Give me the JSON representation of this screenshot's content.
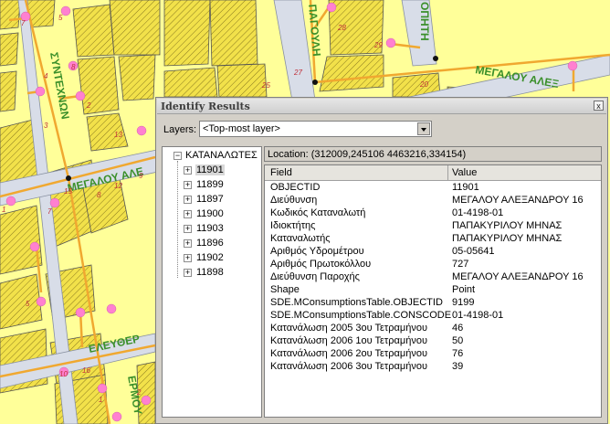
{
  "map": {
    "streets": [
      "ΣΥΝΤΕΧΝΩΝ",
      "ΠΑΓΟΥΛΗ",
      "ΟΠΗΤΗ",
      "ΜΕΓΑΛΟΥ ΑΛΕΞ",
      "ΜΕΓΑΛΟΥ ΑΛΕ",
      "ΕΛΕΥΘΕΡ",
      "ΕΡΜΟΥ"
    ],
    "parcel_numbers": [
      "7",
      "5",
      "8",
      "4",
      "3",
      "2",
      "13",
      "27",
      "28",
      "29",
      "20",
      "25",
      "9",
      "15",
      "12",
      "8",
      "1",
      "7",
      "5",
      "10",
      "16",
      "1",
      "2"
    ],
    "colors": {
      "background": "#ffff99",
      "road": "#d8dde8",
      "pipe": "#f0a830",
      "meter": "#ff80d0",
      "label": "#3a8f2a"
    }
  },
  "dialog": {
    "title": "Identify Results",
    "close_glyph": "x",
    "layers_label": "Layers:",
    "layers_value": "<Top-most layer>",
    "tree": {
      "root": "ΚΑΤΑΝΑΛΩΤΕΣ",
      "root_expander": "−",
      "child_expander": "+",
      "items": [
        "11901",
        "11899",
        "11897",
        "11900",
        "11903",
        "11896",
        "11902",
        "11898"
      ]
    },
    "location_text": "Location: (312009,245106 4463216,334154)",
    "grid": {
      "headers": [
        "Field",
        "Value"
      ],
      "rows": [
        {
          "field": "OBJECTID",
          "value": "11901"
        },
        {
          "field": "Διεύθυνση",
          "value": "ΜΕΓΑΛΟΥ ΑΛΕΞΑΝΔΡΟΥ 16"
        },
        {
          "field": "Κωδικός Καταναλωτή",
          "value": "01-4198-01"
        },
        {
          "field": "Ιδιοκτήτης",
          "value": "ΠΑΠΑΚΥΡΙΛΟΥ ΜΗΝΑΣ"
        },
        {
          "field": "Καταναλωτής",
          "value": "ΠΑΠΑΚΥΡΙΛΟΥ ΜΗΝΑΣ"
        },
        {
          "field": "Αριθμός Υδρομέτρου",
          "value": "05-05641"
        },
        {
          "field": "Αριθμός Πρωτοκόλλου",
          "value": "727"
        },
        {
          "field": "Διεύθυνση Παροχής",
          "value": "ΜΕΓΑΛΟΥ ΑΛΕΞΑΝΔΡΟΥ 16"
        },
        {
          "field": "Shape",
          "value": "Point"
        },
        {
          "field": "SDE.MConsumptionsTable.OBJECTID",
          "value": "9199"
        },
        {
          "field": "SDE.MConsumptionsTable.CONSCODE",
          "value": "01-4198-01"
        },
        {
          "field": "Κατανάλωση 2005 3ου Τετραμήνου",
          "value": "46"
        },
        {
          "field": "Κατανάλωση 2006 1ου Τετραμήνου",
          "value": "50"
        },
        {
          "field": "Κατανάλωση 2006 2ου Τετραμήνου",
          "value": "76"
        },
        {
          "field": "Κατανάλωση 2006 3ου Τετραμήνου",
          "value": "39"
        }
      ]
    }
  }
}
